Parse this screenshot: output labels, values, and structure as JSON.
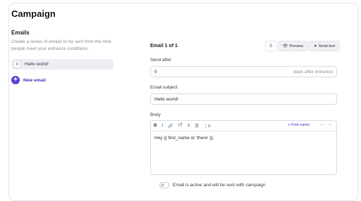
{
  "page": {
    "title": "Campaign"
  },
  "emails": {
    "section_title": "Emails",
    "description": "Create a series of emails to be sent from the time people meet your entrance conditions.",
    "items": [
      {
        "index": "0",
        "label": "Hello world!"
      }
    ],
    "new_email_label": "New email"
  },
  "editor": {
    "header": "Email 1 of 1",
    "counter": "0",
    "preview_label": "Preview",
    "send_test_label": "Send test",
    "send_after": {
      "label": "Send after",
      "value": "0",
      "suffix": "days after entrance"
    },
    "subject": {
      "label": "Email subject",
      "value": "Hello world!"
    },
    "body": {
      "label": "Body",
      "toolbar": {
        "bold": "B",
        "italic": "I",
        "link": "🔗",
        "text_size": "тT",
        "ordered_list": "≡",
        "bullet_list": "☰",
        "numbered_list": "⋮≡",
        "first_name": "+ First name",
        "undo": "↶",
        "redo": "↷"
      },
      "content": "Hey {{ first_name or 'there' }},"
    },
    "active_toggle": {
      "label": "Email is active and will be sent with campaign",
      "on": false
    }
  }
}
